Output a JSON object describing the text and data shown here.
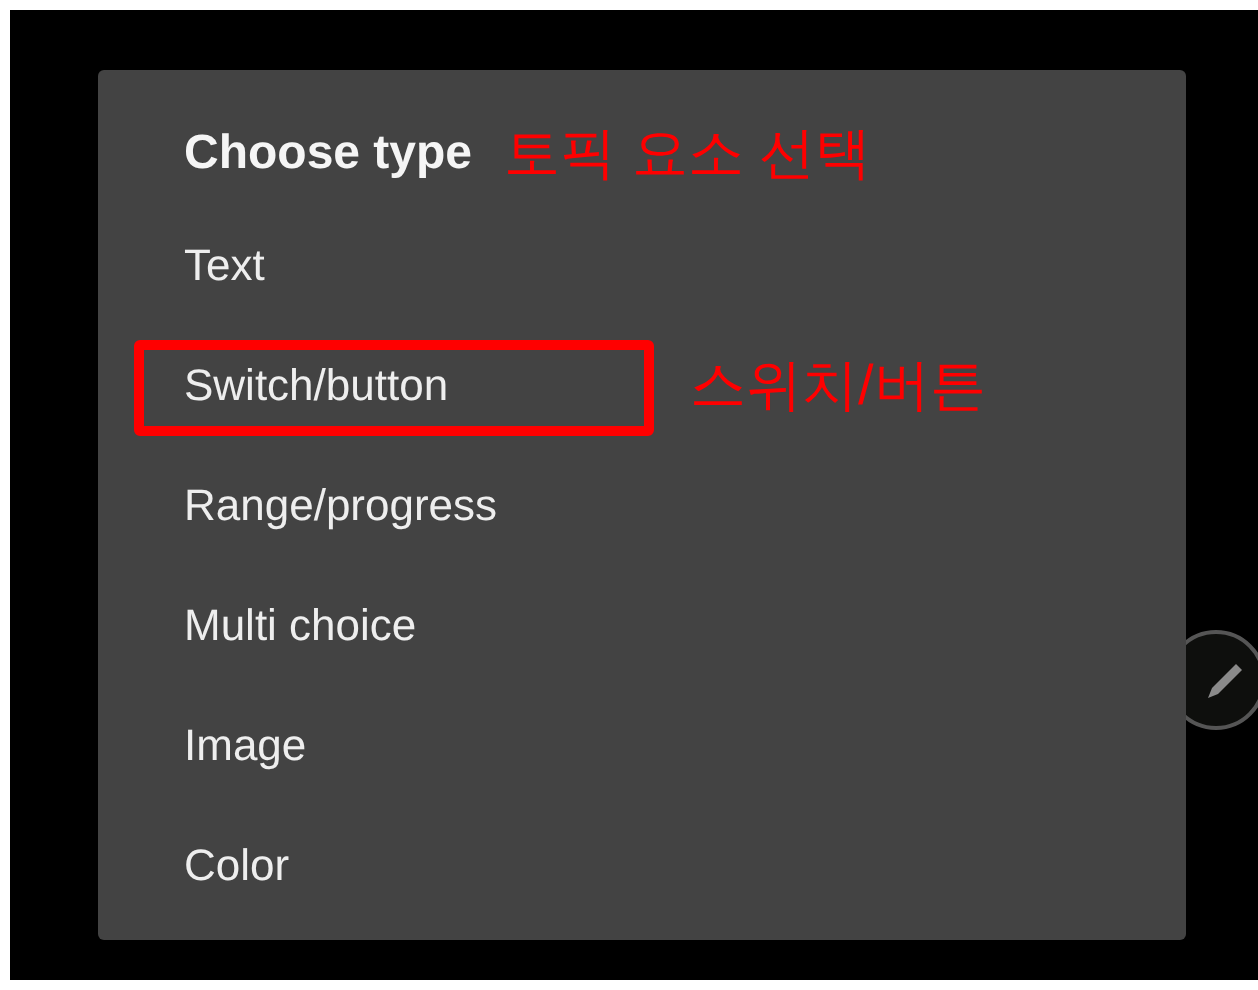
{
  "dialog": {
    "title": "Choose type",
    "title_note": "토픽 요소 선택",
    "items": [
      {
        "label": "Text",
        "highlighted": false
      },
      {
        "label": "Switch/button",
        "highlighted": true,
        "note": "스위치/버튼"
      },
      {
        "label": "Range/progress",
        "highlighted": false
      },
      {
        "label": "Multi choice",
        "highlighted": false
      },
      {
        "label": "Image",
        "highlighted": false
      },
      {
        "label": "Color",
        "highlighted": false
      }
    ]
  }
}
